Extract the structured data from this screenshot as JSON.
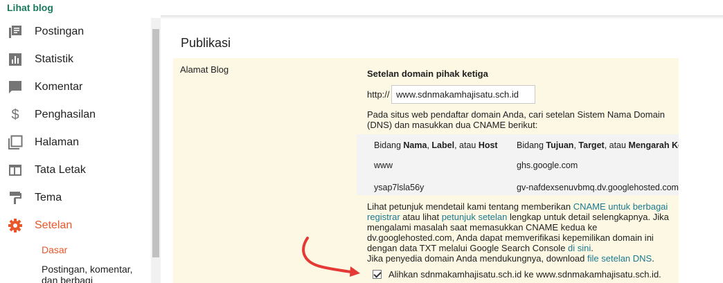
{
  "header": {
    "view_blog_link": "Lihat blog"
  },
  "sidebar": {
    "items": [
      {
        "label": "Postingan",
        "icon": "posts-icon"
      },
      {
        "label": "Statistik",
        "icon": "stats-icon"
      },
      {
        "label": "Komentar",
        "icon": "comment-icon"
      },
      {
        "label": "Penghasilan",
        "icon": "dollar-icon"
      },
      {
        "label": "Halaman",
        "icon": "pages-icon"
      },
      {
        "label": "Tata Letak",
        "icon": "layout-icon"
      },
      {
        "label": "Tema",
        "icon": "theme-icon"
      },
      {
        "label": "Setelan",
        "icon": "gear-icon",
        "active": true
      }
    ],
    "subitems": [
      {
        "label": "Dasar",
        "active": true
      },
      {
        "label": "Postingan, komentar, dan berbagi"
      }
    ]
  },
  "main": {
    "section_title": "Publikasi",
    "row_label": "Alamat Blog",
    "third_party_heading": "Setelan domain pihak ketiga",
    "http_prefix": "http://",
    "domain_value": "www.sdnmakamhajisatu.sch.id",
    "dns_info": "Pada situs web pendaftar domain Anda, cari setelan Sistem Nama Domain (DNS) dan masukkan dua CNAME berikut:",
    "cname_table": {
      "header_col1": {
        "prefix": "Bidang ",
        "b1": "Nama",
        "sep1": ", ",
        "b2": "Label",
        "sep2": ", atau ",
        "b3": "Host"
      },
      "header_col2": {
        "prefix": "Bidang ",
        "b1": "Tujuan",
        "sep1": ", ",
        "b2": "Target",
        "sep2": ", atau ",
        "b3": "Mengarah Ke"
      },
      "rows": [
        {
          "name": "www",
          "target": "ghs.google.com"
        },
        {
          "name": "ysap7lsla56y",
          "target": "gv-nafdexsenuvbmq.dv.googlehosted.com"
        }
      ]
    },
    "help": {
      "t1": "Lihat petunjuk mendetail kami tentang memberikan ",
      "link1": "CNAME untuk berbagai registrar",
      "t2": " atau lihat ",
      "link2": "petunjuk setelan",
      "t3": " lengkap untuk detail selengkapnya. Jika mengalami masalah saat memasukkan CNAME kedua ke dv.googlehosted.com, Anda dapat memverifikasi kepemilikan domain ini dengan data TXT melalui Google Search Console ",
      "link3": "di sini",
      "t4": ".",
      "t5": "Jika penyedia domain Anda mendukungnya, download ",
      "link4": "file setelan DNS",
      "t6": "."
    },
    "redirect_label": "Alihkan sdnmakamhajisatu.sch.id ke www.sdnmakamhajisatu.sch.id.",
    "redirect_checked": true
  },
  "colors": {
    "accent": "#e8562a",
    "link": "#1a7a8f",
    "brand_green": "#1a7a5e",
    "panel_bg": "#fdf8e4",
    "arrow": "#e53935"
  }
}
